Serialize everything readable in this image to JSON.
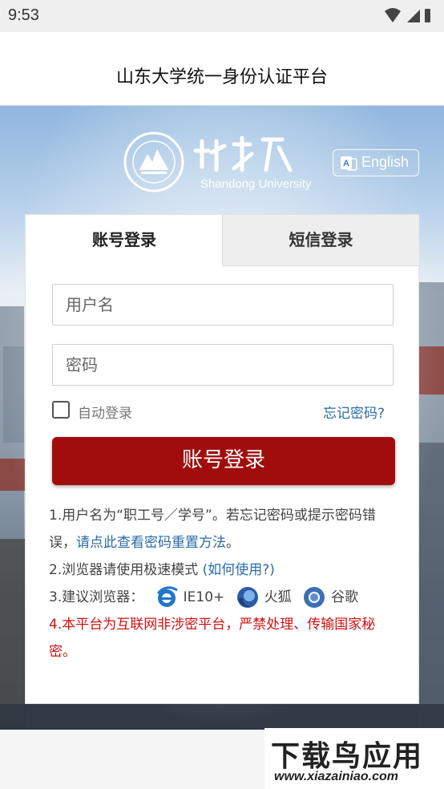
{
  "status_bar": {
    "time": "9:53"
  },
  "header": {
    "title": "山东大学统一身份认证平台"
  },
  "branding": {
    "university_name_cn": "山东大学",
    "university_name_en": "Shandong University",
    "seal_text": "SHANDONG UNIVERSITY"
  },
  "language_toggle": {
    "label": "English"
  },
  "tabs": [
    {
      "label": "账号登录",
      "active": true
    },
    {
      "label": "短信登录",
      "active": false
    }
  ],
  "form": {
    "username_placeholder": "用户名",
    "password_placeholder": "密码",
    "remember_label": "自动登录",
    "forgot_link": "忘记密码?",
    "login_button": "账号登录"
  },
  "notes": {
    "note1_text": "1.用户名为“职工号／学号”。若忘记密码或提示密码错误，",
    "note1_link": "请点此查看密码重置方法",
    "note1_end": "。",
    "note2_text": "2.浏览器请使用极速模式 ",
    "note2_link": "(如何使用?)",
    "note3_text": "3.建议浏览器：",
    "browsers": [
      "IE10+",
      "火狐",
      "谷歌"
    ],
    "note4_text": "4.本平台为互联网非涉密平台，严禁处理、传输国家秘密。"
  },
  "watermark": {
    "title": "下载鸟应用",
    "url": "www.xiazainiao.com"
  },
  "colors": {
    "primary_red": "#a10d0d",
    "link_blue": "#2b6ba8",
    "warning_red": "#d01010"
  }
}
